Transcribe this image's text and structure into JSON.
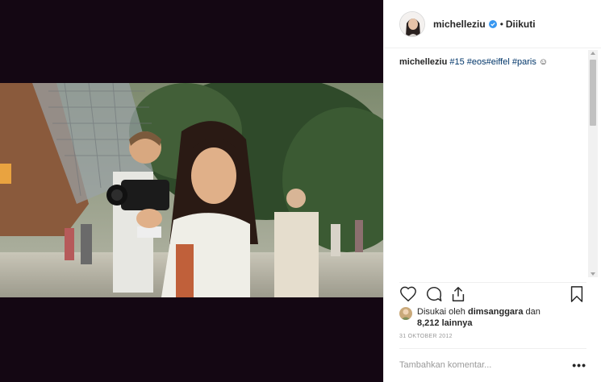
{
  "post": {
    "username": "michelleziu",
    "separator": "•",
    "follow_state": "Diikuti",
    "caption": {
      "username": "michelleziu",
      "hashtags": [
        "#15",
        "#eos",
        "#eiffel",
        "#paris"
      ],
      "emoji": "☺"
    },
    "likes": {
      "prefix": "Disukai oleh",
      "liker": "dimsanggara",
      "conjunction": "dan",
      "count_text": "8,212 lainnya"
    },
    "date": "31 OKTOBER 2012",
    "comment_placeholder": "Tambahkan komentar...",
    "more_icon": "•••"
  },
  "icons": {
    "like": "heart-icon",
    "comment": "comment-icon",
    "share": "share-icon",
    "save": "bookmark-icon",
    "verified": "verified-badge-icon"
  },
  "colors": {
    "media_background": "#140713",
    "hashtag": "#003569",
    "verified": "#3897f0"
  }
}
